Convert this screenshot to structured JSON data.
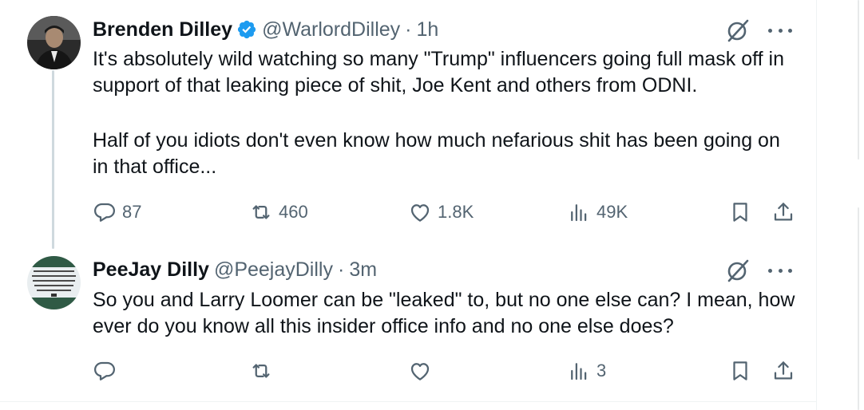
{
  "thread": [
    {
      "author_name": "Brenden Dilley",
      "verified": true,
      "handle": "@WarlordDilley",
      "separator": "·",
      "time": "1h",
      "text_p1": "It's absolutely wild watching so many \"Trump\" influencers going full mask off in support of that leaking piece of shit, Joe Kent and others from ODNI.",
      "text_p2": "Half of you idiots don't even know how much nefarious shit has been going on in that office...",
      "replies": "87",
      "reposts": "460",
      "likes": "1.8K",
      "views": "49K",
      "header_icons": [
        "grok-icon",
        "more-icon"
      ],
      "action_icons": [
        "reply-icon",
        "repost-icon",
        "like-icon",
        "views-icon",
        "bookmark-icon",
        "share-icon"
      ]
    },
    {
      "author_name": "PeeJay Dilly",
      "verified": false,
      "handle": "@PeejayDilly",
      "separator": "·",
      "time": "3m",
      "text": "So you and Larry Loomer can be \"leaked\" to, but no one else can? I mean, how ever do you know all this insider office info and no one else does?",
      "replies": "",
      "reposts": "",
      "likes": "",
      "views": "3",
      "header_icons": [
        "grok-icon",
        "more-icon"
      ],
      "action_icons": [
        "reply-icon",
        "repost-icon",
        "like-icon",
        "views-icon",
        "bookmark-icon",
        "share-icon"
      ]
    }
  ],
  "colors": {
    "text": "#0f1419",
    "secondary": "#536471",
    "verified_blue": "#1d9bf0",
    "thread_line": "#cfd9de",
    "divider": "#eff3f4"
  }
}
